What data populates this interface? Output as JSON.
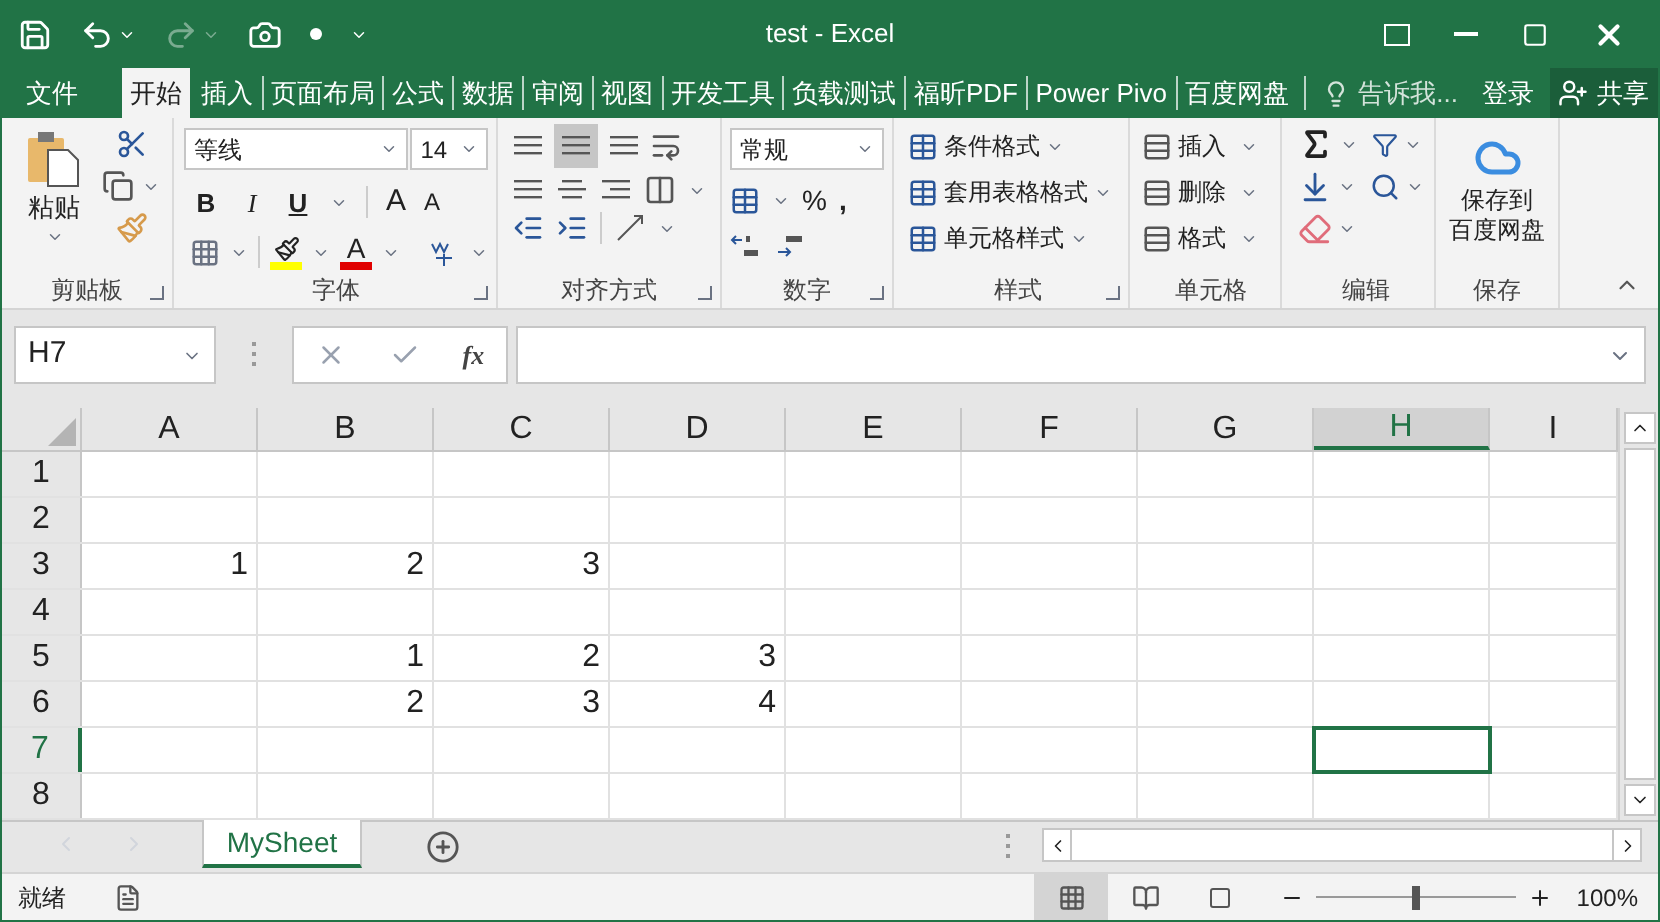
{
  "title_bar": {
    "title": "test - Excel"
  },
  "tabs": [
    {
      "label": "文件",
      "selected": false
    },
    {
      "label": "开始",
      "selected": true
    },
    {
      "label": "插入",
      "selected": false
    },
    {
      "label": "页面布局",
      "selected": false
    },
    {
      "label": "公式",
      "selected": false
    },
    {
      "label": "数据",
      "selected": false
    },
    {
      "label": "审阅",
      "selected": false
    },
    {
      "label": "视图",
      "selected": false
    },
    {
      "label": "开发工具",
      "selected": false
    },
    {
      "label": "负载测试",
      "selected": false
    },
    {
      "label": "福昕PDF",
      "selected": false
    },
    {
      "label": "Power Pivo",
      "selected": false
    },
    {
      "label": "百度网盘",
      "selected": false
    }
  ],
  "tell_me": {
    "placeholder": "告诉我..."
  },
  "sign_in": "登录",
  "share": "共享",
  "ribbon": {
    "clipboard": {
      "label": "剪贴板",
      "paste": "粘贴"
    },
    "font": {
      "label": "字体",
      "font_name": "等线",
      "font_size": "14",
      "styles": [
        "B",
        "I",
        "U"
      ],
      "grow": "A",
      "shrink": "A",
      "font_color": "A"
    },
    "alignment": {
      "label": "对齐方式",
      "vertical": [
        {
          "selected": false
        },
        {
          "selected": true
        },
        {
          "selected": false
        }
      ]
    },
    "number": {
      "label": "数字",
      "format": "常规",
      "percent": "%",
      "comma": ","
    },
    "styles": {
      "label": "样式",
      "items": [
        "条件格式",
        "套用表格格式",
        "单元格样式"
      ]
    },
    "cells": {
      "label": "单元格",
      "items": [
        "插入",
        "删除",
        "格式"
      ]
    },
    "editing": {
      "label": "编辑"
    },
    "save": {
      "label": "保存",
      "button": "保存到百度网盘"
    }
  },
  "formula_bar": {
    "name_box": "H7",
    "function": "fx"
  },
  "grid": {
    "columns": [
      {
        "label": "A",
        "selected": false
      },
      {
        "label": "B",
        "selected": false
      },
      {
        "label": "C",
        "selected": false
      },
      {
        "label": "D",
        "selected": false
      },
      {
        "label": "E",
        "selected": false
      },
      {
        "label": "F",
        "selected": false
      },
      {
        "label": "G",
        "selected": false
      },
      {
        "label": "H",
        "selected": true
      },
      {
        "label": "I",
        "selected": false
      }
    ],
    "rows": [
      {
        "label": "1",
        "selected": false,
        "cells": []
      },
      {
        "label": "2",
        "selected": false,
        "cells": []
      },
      {
        "label": "3",
        "selected": false,
        "cells": [
          "1",
          "2",
          "3"
        ]
      },
      {
        "label": "4",
        "selected": false,
        "cells": []
      },
      {
        "label": "5",
        "selected": false,
        "cells": [
          null,
          "1",
          "2",
          "3"
        ]
      },
      {
        "label": "6",
        "selected": false,
        "cells": [
          null,
          "2",
          "3",
          "4"
        ]
      },
      {
        "label": "7",
        "selected": true,
        "cells": []
      },
      {
        "label": "8",
        "selected": false,
        "cells": []
      }
    ]
  },
  "sheet_tabs": [
    {
      "label": "MySheet",
      "selected": true
    }
  ],
  "status_bar": {
    "status": "就绪",
    "views": [
      {
        "selected": true
      },
      {
        "selected": false
      },
      {
        "selected": false
      }
    ],
    "zoom": {
      "level": 0.5
    },
    "zoom_label": "100%"
  }
}
